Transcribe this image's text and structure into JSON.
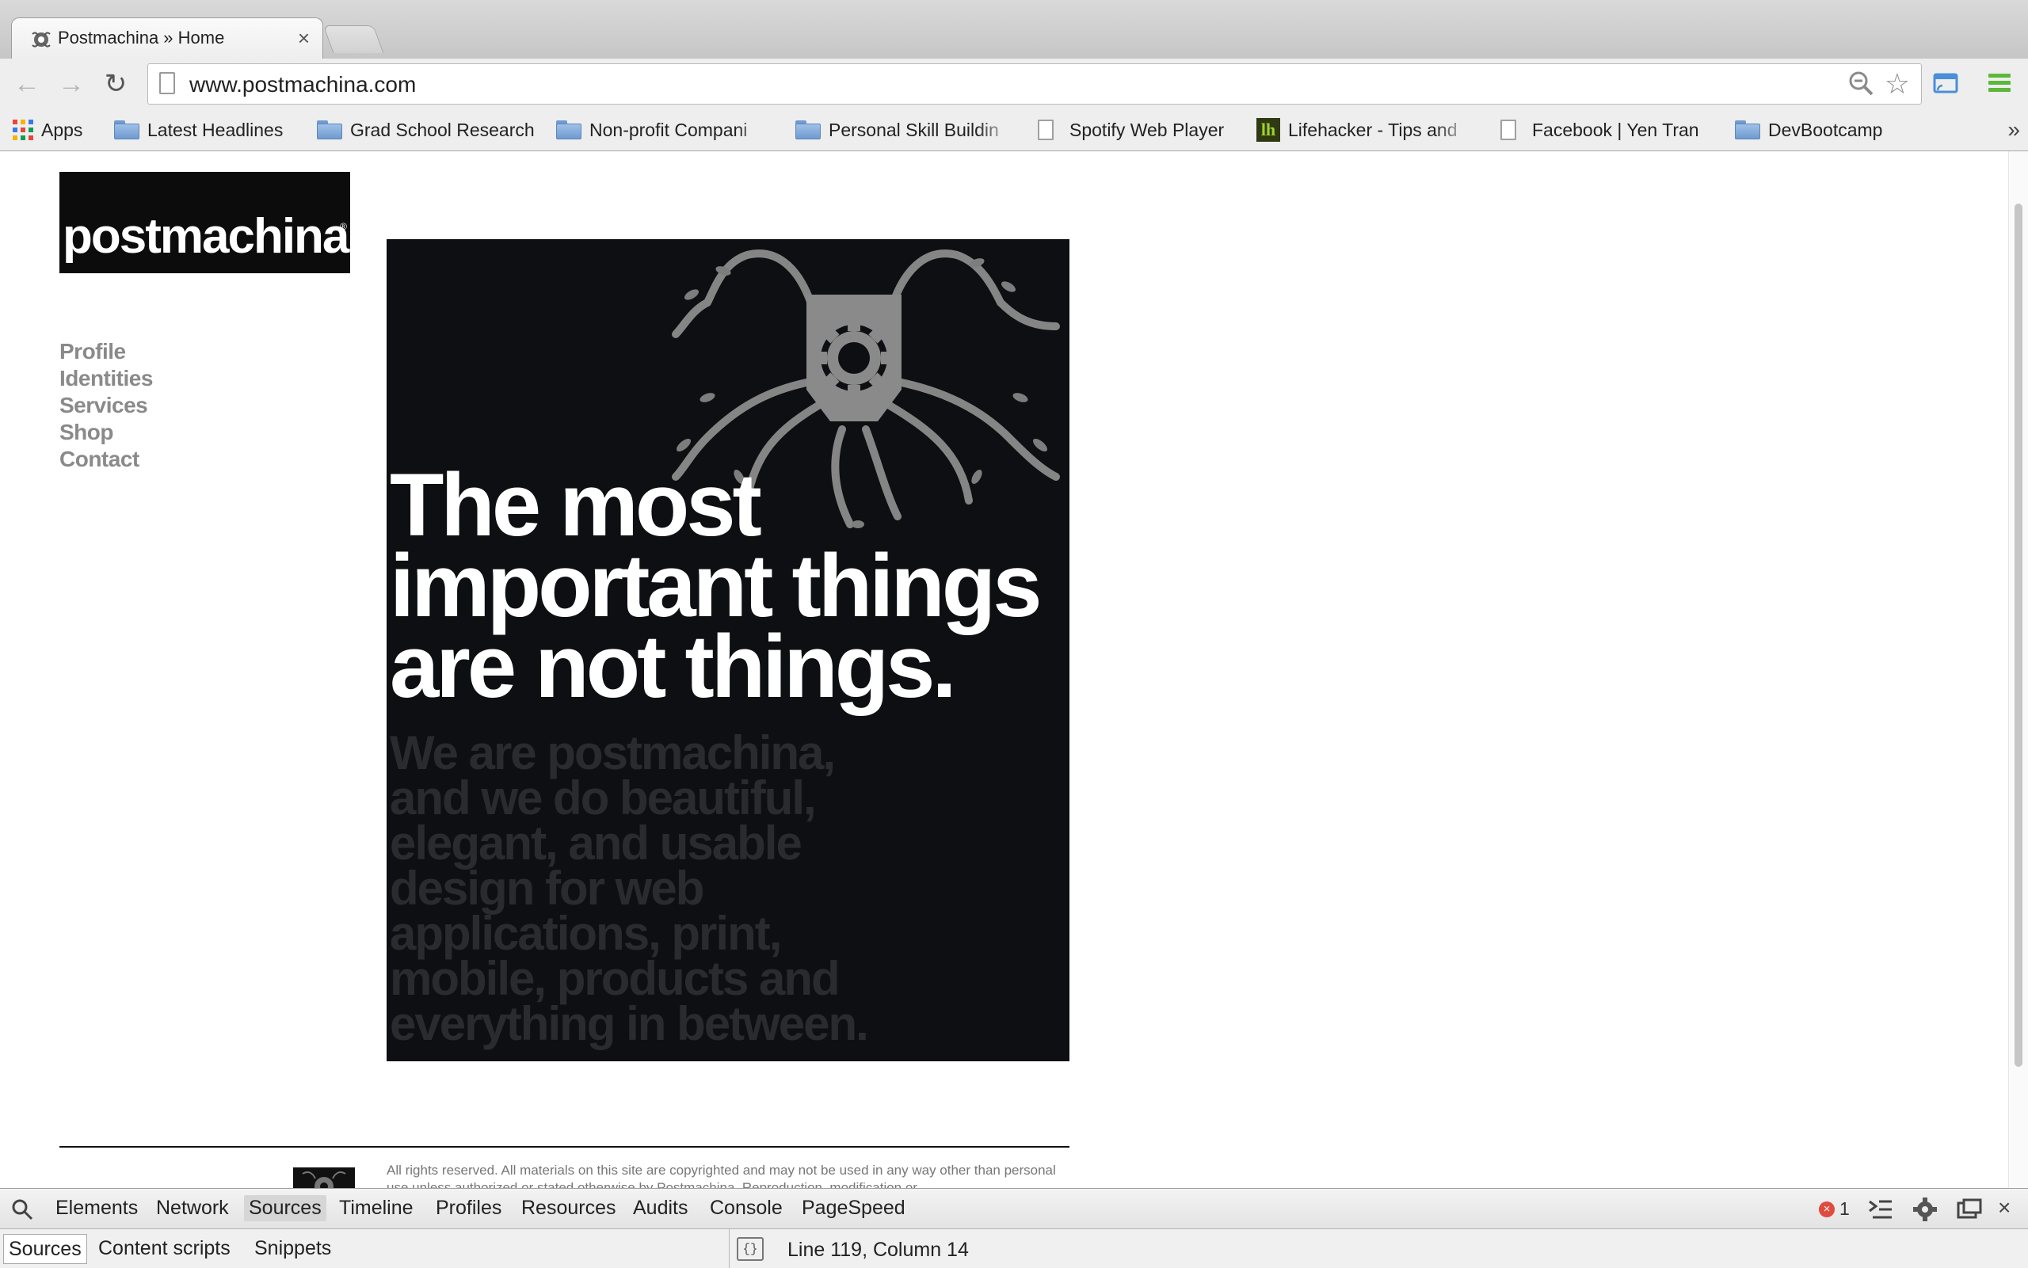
{
  "browser": {
    "tab_title": "Postmachina » Home",
    "tab_close": "×",
    "url": "www.postmachina.com",
    "back_glyph": "←",
    "forward_glyph": "→",
    "reload_glyph": "↻",
    "star_glyph": "☆",
    "bookmarks": [
      {
        "label": "Apps",
        "icon": "apps-grid-icon"
      },
      {
        "label": "Latest Headlines",
        "icon": "folder-icon"
      },
      {
        "label": "Grad School Research",
        "icon": "folder-icon"
      },
      {
        "label": "Non-profit Compani",
        "icon": "folder-icon"
      },
      {
        "label": "Personal Skill Buildin",
        "icon": "folder-icon"
      },
      {
        "label": "Spotify Web Player",
        "icon": "page-icon"
      },
      {
        "label": "Lifehacker - Tips and",
        "icon": "lifehacker-icon"
      },
      {
        "label": "Facebook | Yen Tran",
        "icon": "page-icon"
      },
      {
        "label": "DevBootcamp",
        "icon": "folder-icon"
      }
    ],
    "bookmarks_more": "»",
    "lifehacker_glyph": "lh"
  },
  "site": {
    "logo_text": "postmachina",
    "logo_reg": "®",
    "nav": [
      "Profile",
      "Identities",
      "Services",
      "Shop",
      "Contact"
    ],
    "hero_headline": "The most important things are not things.",
    "hero_sub": "We are postmachina, and we do beautiful, elegant, and usable design for web applications, print, mobile, products and everything in between.",
    "footer_text": "All rights reserved. All materials on this site are copyrighted and may not be used in any way other than personal use unless authorized or stated otherwise by Postmachina. Reproduction, modification or"
  },
  "devtools": {
    "tabs": [
      "Elements",
      "Network",
      "Sources",
      "Timeline",
      "Profiles",
      "Resources",
      "Audits",
      "Console",
      "PageSpeed"
    ],
    "active_tab": "Sources",
    "error_count": "1",
    "error_glyph": "×",
    "subtabs": [
      "Sources",
      "Content scripts",
      "Snippets"
    ],
    "status": "Line 119, Column 14",
    "format_glyph": "{}",
    "close_glyph": "×"
  },
  "colors": {
    "hero_bg": "#0d0f12",
    "nav_text": "#8a8a8a",
    "hero_sub": "#2a2b2e"
  }
}
